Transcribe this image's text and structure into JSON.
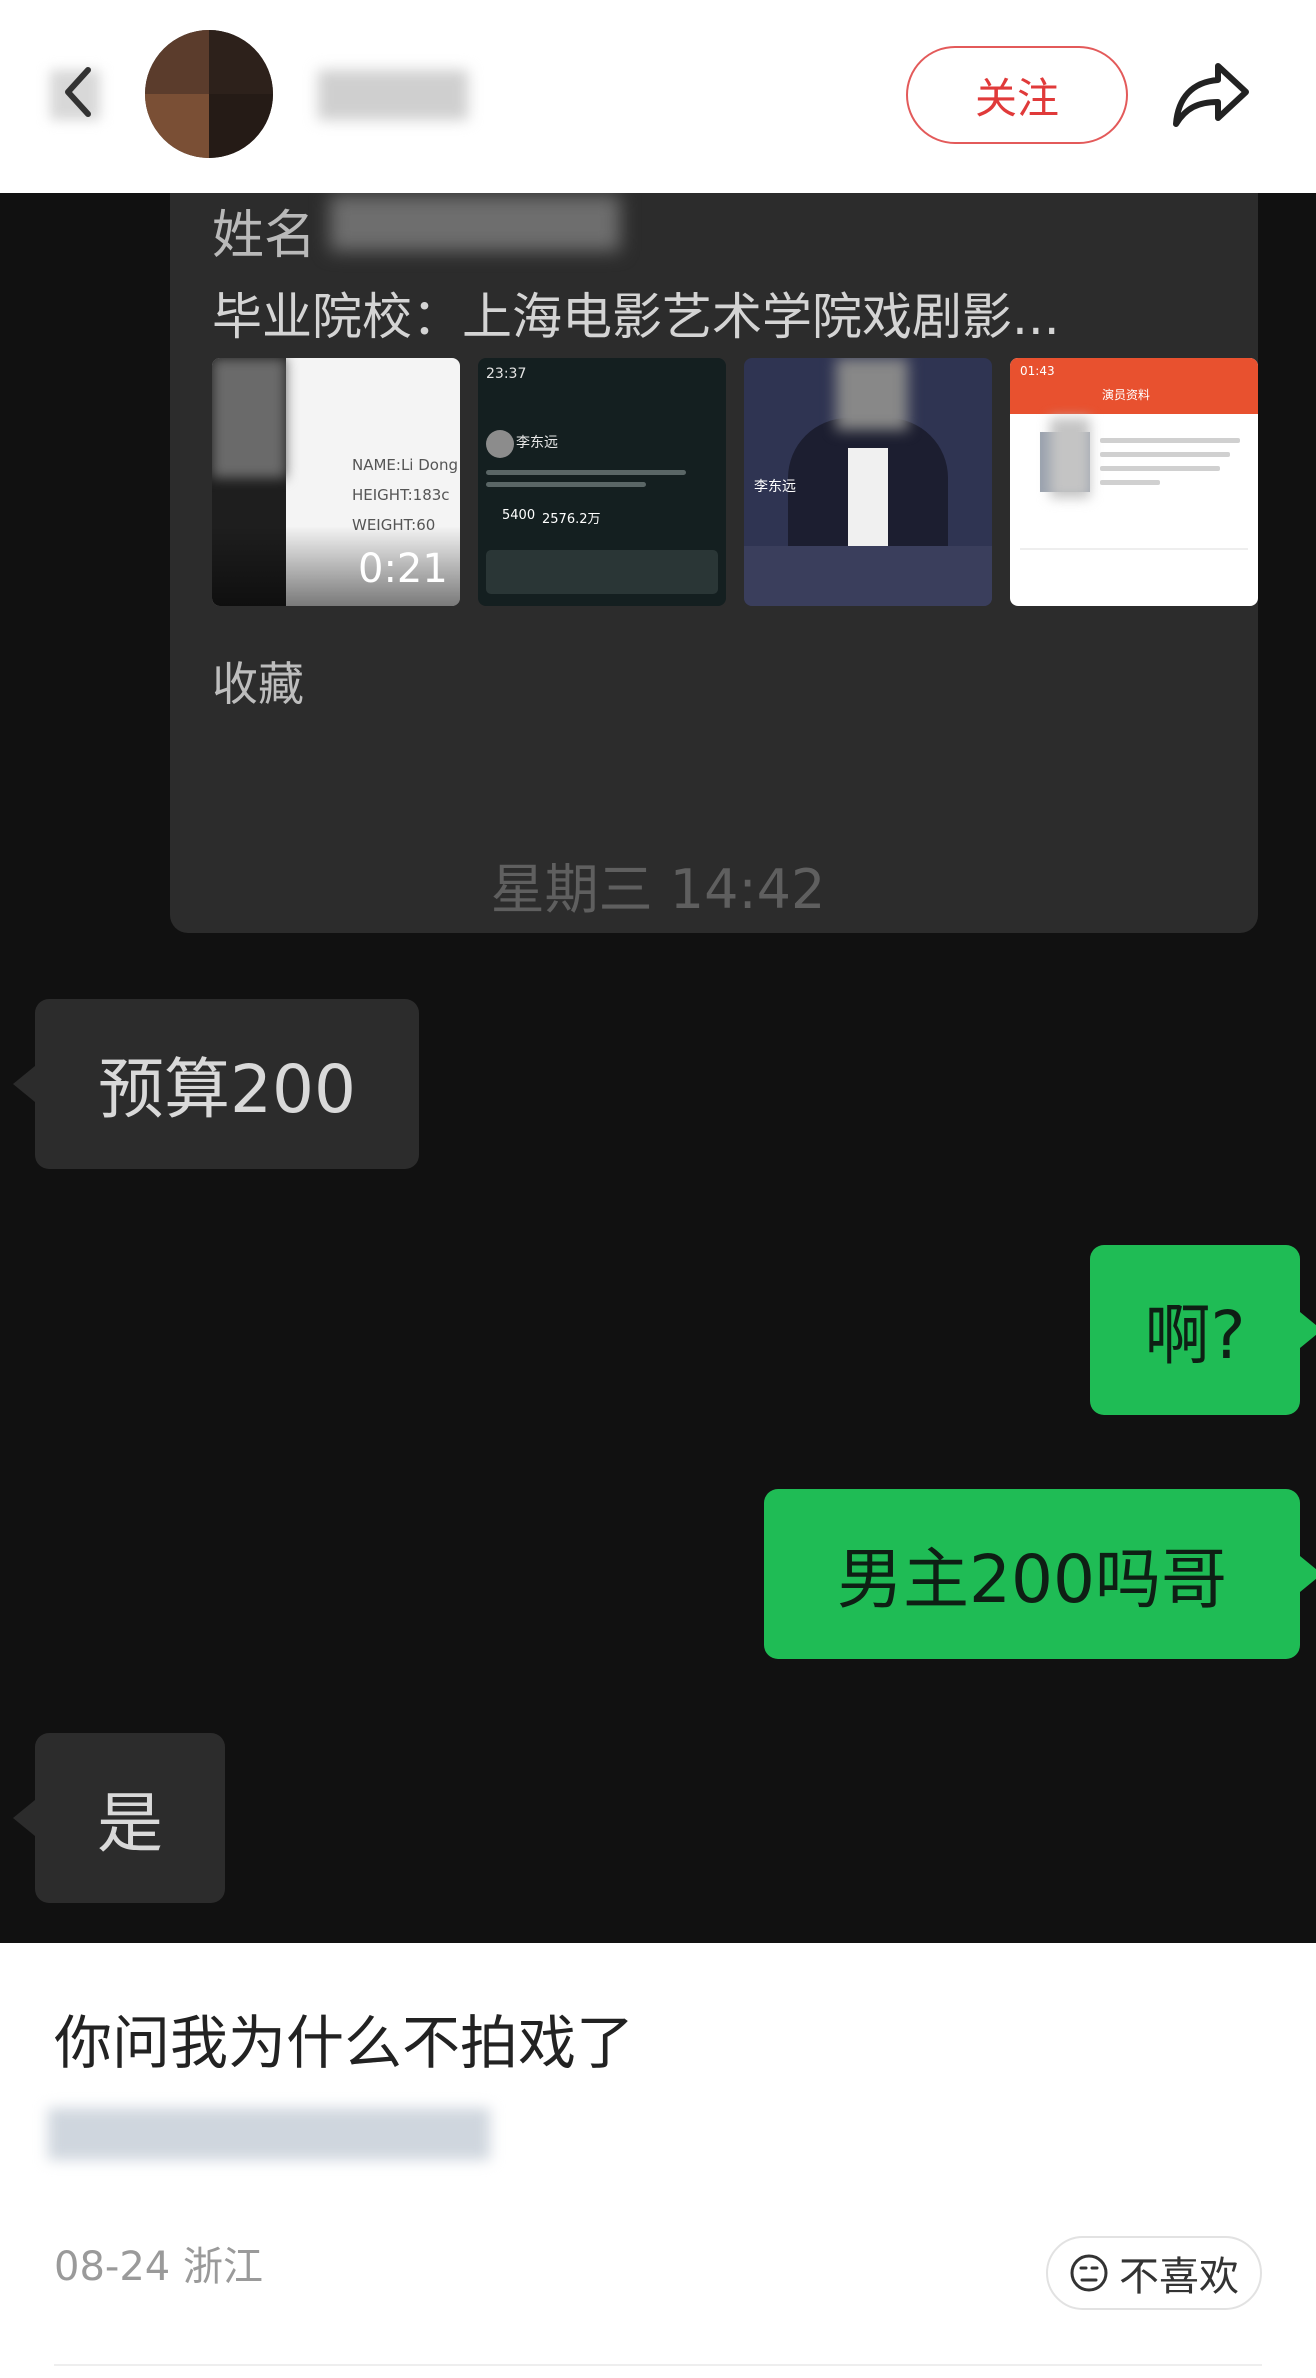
{
  "header": {
    "back_icon": "chevron-left-icon",
    "follow_label": "关注",
    "share_icon": "share-arrow-icon"
  },
  "chat": {
    "card": {
      "name_label": "姓名",
      "school": "毕业院校：上海电影艺术学院戏剧影...",
      "thumbnails": {
        "t1_meta_name": "NAME:Li Dong",
        "t1_meta_height": "HEIGHT:183c",
        "t1_meta_weight": "WEIGHT:60",
        "t1_duration": "0:21",
        "t2_status": "23:37",
        "t2_name": "李东远",
        "t2_num1": "5400",
        "t2_num2": "2576.2万",
        "t3_name": "李东远",
        "t4_time": "01:43",
        "t4_title": "演员资料"
      },
      "favorite_label": "收藏"
    },
    "timestamp": "星期三 14:42",
    "messages": [
      {
        "side": "left",
        "text": "预算200"
      },
      {
        "side": "right",
        "text": "啊?"
      },
      {
        "side": "right",
        "text": "男主200吗哥"
      },
      {
        "side": "left",
        "text": "是"
      }
    ]
  },
  "post": {
    "caption": "你问我为什么不拍戏了",
    "date": "08-24",
    "location": "浙江",
    "dislike_label": "不喜欢"
  },
  "colors": {
    "follow_red": "#e03a3a",
    "bubble_green": "#1fbc55",
    "chat_bg": "#111111",
    "bubble_gray": "#2c2c2c"
  }
}
